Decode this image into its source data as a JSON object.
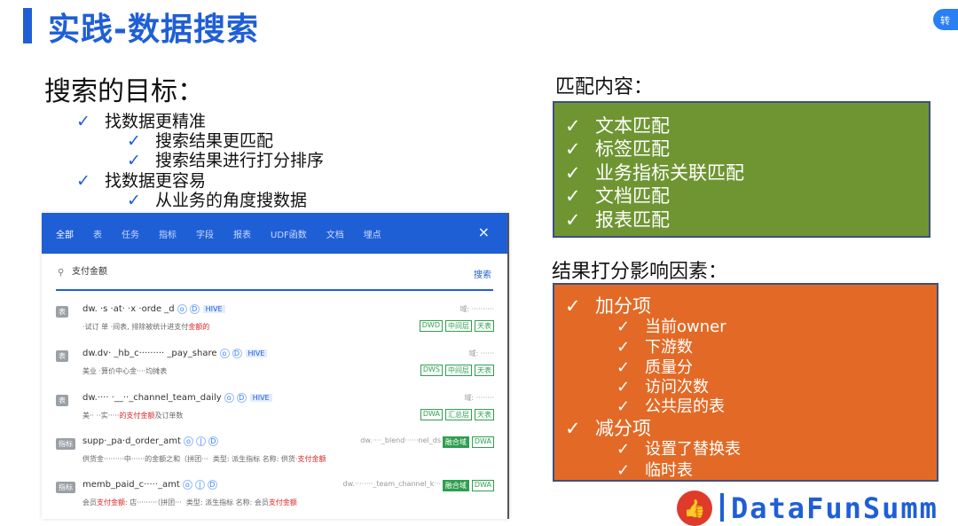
{
  "slide": {
    "title": "实践-数据搜索",
    "corner_badge": "转"
  },
  "goals": {
    "heading": "搜索的目标：",
    "items": [
      {
        "text": "找数据更精准",
        "level": 1
      },
      {
        "text": "搜索结果更匹配",
        "level": 2
      },
      {
        "text": "搜索结果进行打分排序",
        "level": 2
      },
      {
        "text": "找数据更容易",
        "level": 1
      },
      {
        "text": "从业务的角度搜数据",
        "level": 2
      }
    ],
    "check_glyph": "✓"
  },
  "search_ui": {
    "tabs": [
      "全部",
      "表",
      "任务",
      "指标",
      "字段",
      "报表",
      "UDF函数",
      "文档",
      "埋点"
    ],
    "active_tab": "全部",
    "close_icon": "×",
    "search_icon": "🔍",
    "query": "支付金额",
    "search_button": "搜索",
    "results": [
      {
        "type": "表",
        "name": "dw. ·s  ·at·  ·x  ·orde  _d",
        "storage": "HIVE",
        "desc_a": "·试订 单 ·间表, 排除",
        "desc_b": "被统计进支付",
        "desc_c": "金额的",
        "right": "域: ··········",
        "tags": [
          "DWD",
          "中间层",
          "天表"
        ]
      },
      {
        "type": "表",
        "name": "dw.dv·  _hb_c·········  _pay_share",
        "storage": "HIVE",
        "desc_a": "美业 ·算价中心金·",
        "desc_b": "",
        "desc_c": "···均摊表",
        "right": "域: ······",
        "tags": [
          "DWS",
          "中间层",
          "天表"
        ]
      },
      {
        "type": "表",
        "name": "dw.····  ·__··_channel_team_daily",
        "storage": "HIVE",
        "desc_a": "美·· ··实·····",
        "desc_b": "的支付金额",
        "desc_c": "及订单数",
        "right": "域: ········",
        "tags": [
          "DWA",
          "汇总层",
          "天表"
        ]
      },
      {
        "type": "指标",
        "name": "supp·_pa·d_order_amt",
        "storage": "",
        "desc_a": "供货金·········中······",
        "desc_b": "",
        "desc_c": "的金额之和（拼团···",
        "right": "dw.····_blend······nel_ds",
        "meta_type": "类型: 派生指标",
        "meta_name": "名称: 供货·",
        "meta_val": "支付金额",
        "tags": [
          "融合域",
          "DWA"
        ]
      },
      {
        "type": "指标",
        "name": "memb_paid_c·····_amt",
        "storage": "",
        "desc_a": "会员",
        "desc_b": "支付金额",
        "desc_c": ": 店·········（拼团···",
        "right": "dw.········_team_channel_k···",
        "meta_type": "类型: 派生指标",
        "meta_name": "名称: 会员",
        "meta_val": "支付金额",
        "tags": [
          "融合域",
          "DWA"
        ]
      }
    ]
  },
  "match": {
    "heading": "匹配内容：",
    "items": [
      "文本匹配",
      "标签匹配",
      "业务指标关联匹配",
      "文档匹配",
      "报表匹配"
    ],
    "box_color": "#6f9533"
  },
  "score": {
    "heading": "结果打分影响因素：",
    "items": [
      {
        "text": "加分项",
        "level": 1
      },
      {
        "text": "当前owner",
        "level": 2
      },
      {
        "text": "下游数",
        "level": 2
      },
      {
        "text": "质量分",
        "level": 2
      },
      {
        "text": "访问次数",
        "level": 2
      },
      {
        "text": "公共层的表",
        "level": 2
      },
      {
        "text": "减分项",
        "level": 1
      },
      {
        "text": "设置了替换表",
        "level": 2
      },
      {
        "text": "临时表",
        "level": 2
      }
    ],
    "box_color": "#e26a26"
  },
  "footer": {
    "logo_glyph": "👍",
    "brand": "DataFunSumm"
  }
}
